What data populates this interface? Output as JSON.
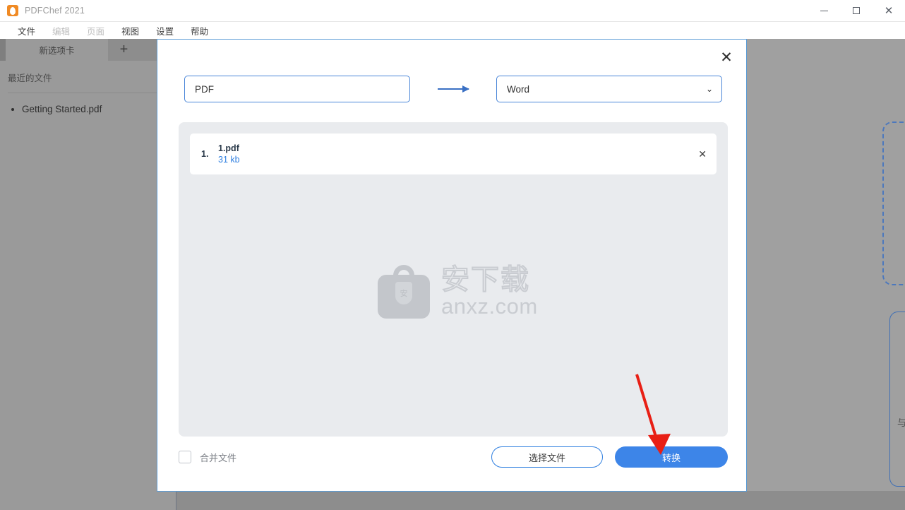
{
  "window": {
    "title": "PDFChef 2021",
    "logo_icon": "pdfchef-logo-icon",
    "minimize_icon": "minimize-icon",
    "maximize_icon": "maximize-icon",
    "close_icon": "close-icon"
  },
  "menubar": {
    "items": [
      {
        "label": "文件",
        "enabled": true
      },
      {
        "label": "编辑",
        "enabled": false
      },
      {
        "label": "页面",
        "enabled": false
      },
      {
        "label": "视图",
        "enabled": true
      },
      {
        "label": "设置",
        "enabled": true
      },
      {
        "label": "帮助",
        "enabled": true
      }
    ]
  },
  "sidebar": {
    "tab_label": "新选项卡",
    "add_tab_label": "+",
    "recent_title": "最近的文件",
    "recent_files": [
      {
        "name": "Getting Started.pdf"
      }
    ]
  },
  "background": {
    "card_text": "与 PDF 格式相互转换"
  },
  "dialog": {
    "close_label": "✕",
    "source_format": "PDF",
    "arrow_icon": "arrow-right-icon",
    "target_format": "Word",
    "caret_icon": "chevron-down-icon",
    "files": [
      {
        "index": "1.",
        "name": "1.pdf",
        "size": "31 kb",
        "remove_icon": "✕"
      }
    ],
    "watermark": {
      "bag_icon": "shopping-bag-icon",
      "shield_text": "安",
      "brand_cn": "安下载",
      "brand_url": "anxz.com"
    },
    "merge_checkbox_label": "合并文件",
    "merge_checked": false,
    "choose_files_label": "选择文件",
    "convert_label": "转换"
  },
  "colors": {
    "accent_blue": "#3d85e8",
    "border_blue": "#4a86d8",
    "link_blue": "#2f7fe0",
    "logo_orange": "#f08a24",
    "annotation_red": "#e81f15"
  }
}
